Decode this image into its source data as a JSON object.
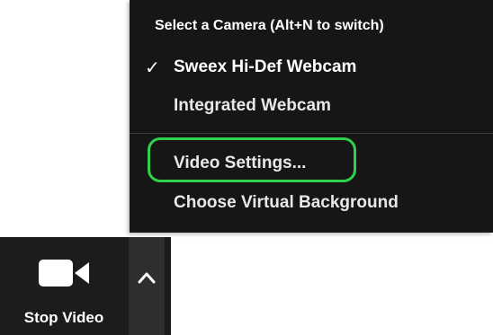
{
  "camera_menu": {
    "header": "Select a Camera (Alt+N to switch)",
    "items": [
      {
        "label": "Sweex Hi-Def Webcam",
        "checked": true,
        "check_glyph": "✓"
      },
      {
        "label": "Integrated Webcam",
        "checked": false
      },
      {
        "label": "Video Settings...",
        "checked": false,
        "highlighted": true
      },
      {
        "label": "Choose Virtual Background",
        "checked": false
      }
    ],
    "highlight_color": "#2fd24a"
  },
  "toolbar": {
    "stop_video_label": "Stop Video",
    "camera_icon": "video-camera-icon",
    "options_icon": "chevron-up-icon"
  }
}
